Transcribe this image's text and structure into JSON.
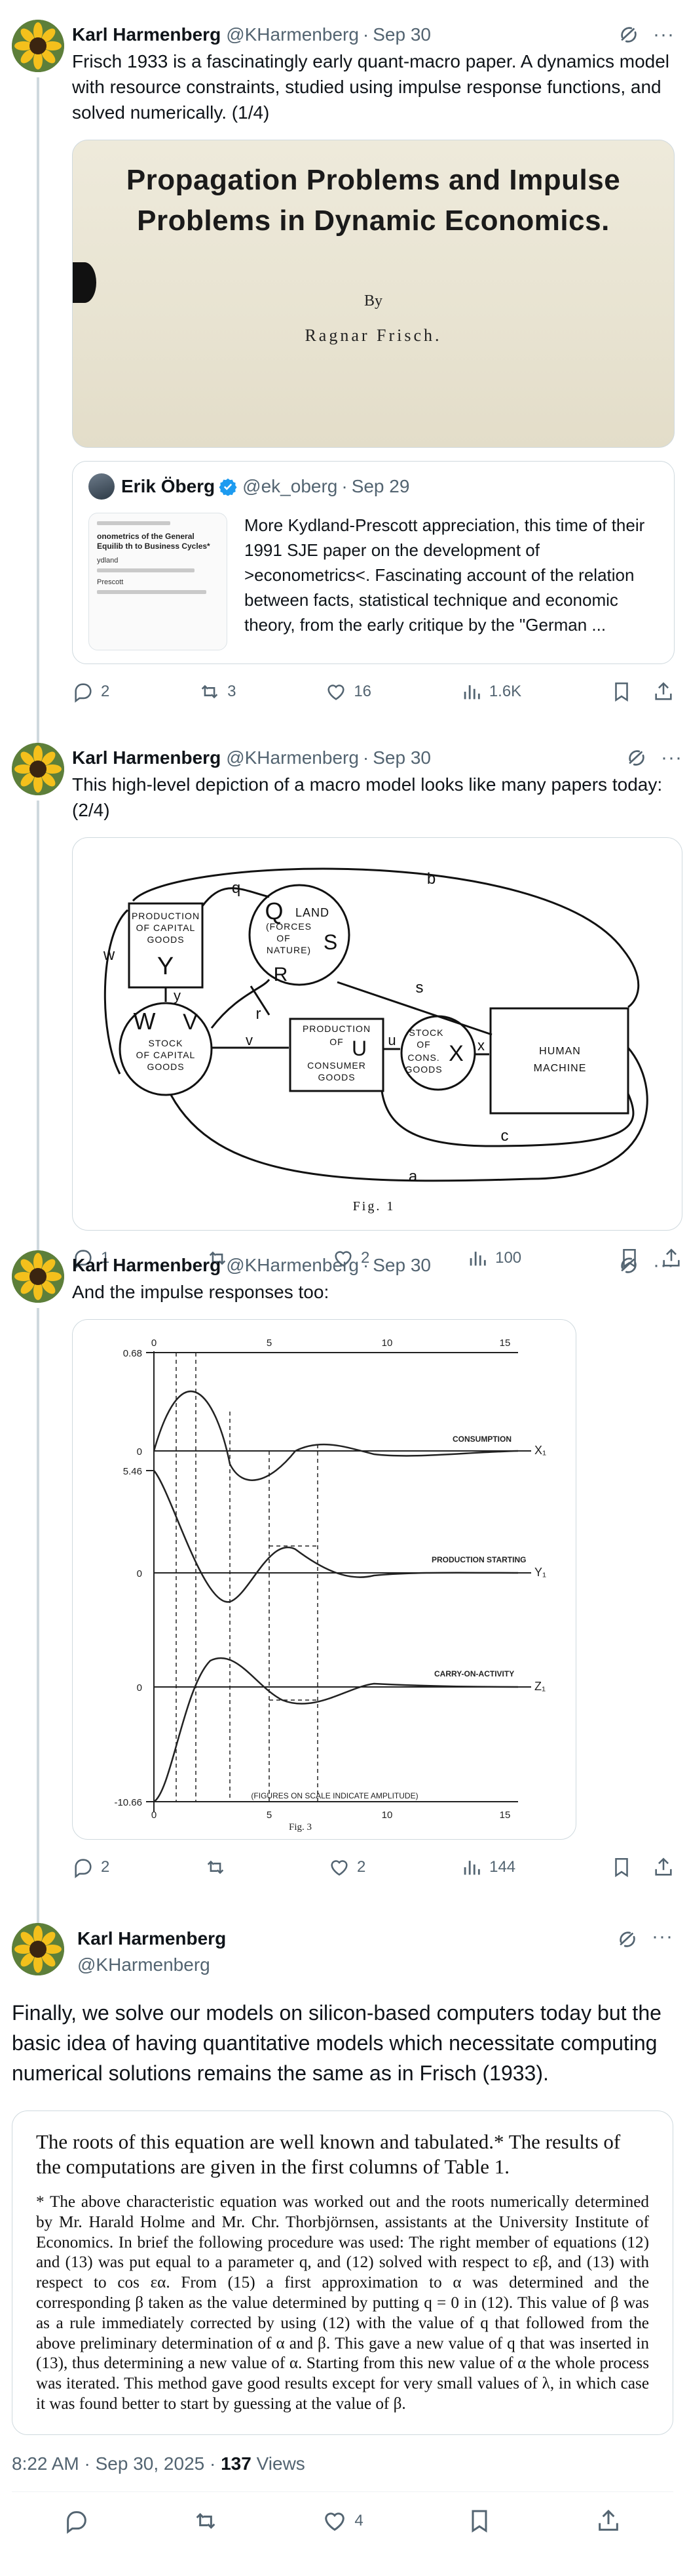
{
  "tweets": [
    {
      "name": "Karl Harmenberg",
      "handle": "@KHarmenberg",
      "date": "Sep 30",
      "text": "Frisch 1933 is a fascinatingly early quant-macro paper. A dynamics model with resource constraints, studied using impulse response functions, and solved numerically. (1/4)",
      "image": {
        "title_line1": "Propagation Problems and Impulse",
        "title_line2": "Problems in Dynamic Economics.",
        "by": "By",
        "author": "Ragnar Frisch."
      },
      "quote": {
        "name": "Erik Öberg",
        "handle": "@ek_oberg",
        "date": "Sep 29",
        "text": "More Kydland-Prescott appreciation, this time of their 1991 SJE paper on the development of >econometrics<. Fascinating account of the relation between facts, statistical technique and economic theory, from the early critique by the \"German ...",
        "thumb_title": "onometrics of the General Equilib th to Business Cycles*",
        "thumb_author": "ydland",
        "thumb_author2": "Prescott"
      },
      "stats": {
        "replies": "2",
        "reposts": "3",
        "likes": "16",
        "views": "1.6K"
      }
    },
    {
      "name": "Karl Harmenberg",
      "handle": "@KHarmenberg",
      "date": "Sep 30",
      "text": "This high-level depiction of a macro model looks like many papers today: (2/4)",
      "diagram": {
        "prod_capital": [
          "PRODUCTION",
          "OF CAPITAL",
          "GOODS"
        ],
        "prod_capital_var": "Y",
        "land": [
          "LAND",
          "(FORCES",
          "OF",
          "NATURE)"
        ],
        "land_q": "Q",
        "land_r": "R",
        "land_s": "S",
        "stock_capital": [
          "STOCK",
          "OF CAPITAL",
          "GOODS"
        ],
        "stock_capital_w": "W",
        "stock_capital_v": "V",
        "prod_consumer": [
          "PRODUCTION",
          "OF",
          "CONSUMER",
          "GOODS"
        ],
        "prod_consumer_var": "U",
        "stock_cons": [
          "STOCK",
          "OF",
          "CONS.",
          "GOODS"
        ],
        "stock_cons_var": "X",
        "human": [
          "HUMAN",
          "MACHINE"
        ],
        "labels": {
          "b": "b",
          "q": "q",
          "w": "w",
          "y": "y",
          "r": "r",
          "v": "v",
          "s": "s",
          "u": "u",
          "x": "x",
          "c": "c",
          "a": "a"
        },
        "caption": "Fig. 1"
      },
      "stats": {
        "replies": "1",
        "reposts": "",
        "likes": "2",
        "views": "100"
      }
    },
    {
      "name": "Karl Harmenberg",
      "handle": "@KHarmenberg",
      "date": "Sep 30",
      "text": "And the impulse responses too:",
      "chart": {
        "top_ticks": [
          "0",
          "5",
          "10",
          "15"
        ],
        "bottom_ticks": [
          "0",
          "5",
          "10",
          "15"
        ],
        "y_labels": [
          "0.68",
          "0",
          "5.46",
          "0",
          "0",
          "-10.66"
        ],
        "curve_labels": [
          "CONSUMPTION",
          "PRODUCTION STARTING",
          "CARRY-ON-ACTIVITY"
        ],
        "curve_vars": [
          "X₁",
          "Y₁",
          "Z₁"
        ],
        "note": "(FIGURES ON SCALE INDICATE AMPLITUDE)",
        "caption": "Fig. 3"
      },
      "stats": {
        "replies": "2",
        "reposts": "",
        "likes": "2",
        "views": "144"
      }
    }
  ],
  "final": {
    "name": "Karl Harmenberg",
    "handle": "@KHarmenberg",
    "text": "Finally, we solve our models on silicon-based computers today but the basic idea of having quantitative models which necessitate computing numerical solutions remains the same as in Frisch (1933).",
    "para1": "The roots of this equation are well known and tabulated.* The results of the computations are given in the first columns of Table 1.",
    "para2": "* The above characteristic equation was worked out and the roots numerically determined by Mr. Harald Holme and Mr. Chr. Thorbjörnsen, assistants at the University Institute of Economics. In brief the following procedure was used: The right member of equations (12) and (13) was put equal to a parameter q, and (12) solved with respect to εβ, and (13) with respect to cos εα. From (15) a first approximation to α was determined and the corresponding β taken as the value determined by putting q = 0 in (12). This value of β was as a rule immediately corrected by using (12) with the value of q that followed from the above preliminary determination of α and β. This gave a new value of q that was inserted in (13), thus determining a new value of α. Starting from this new value of α the whole process was iterated. This method gave good results except for very small values of λ, in which case it was found better to start by guessing at the value of β.",
    "time": "8:22 AM",
    "date": "Sep 30, 2025",
    "views_count": "137",
    "views_label": "Views",
    "likes": "4"
  }
}
